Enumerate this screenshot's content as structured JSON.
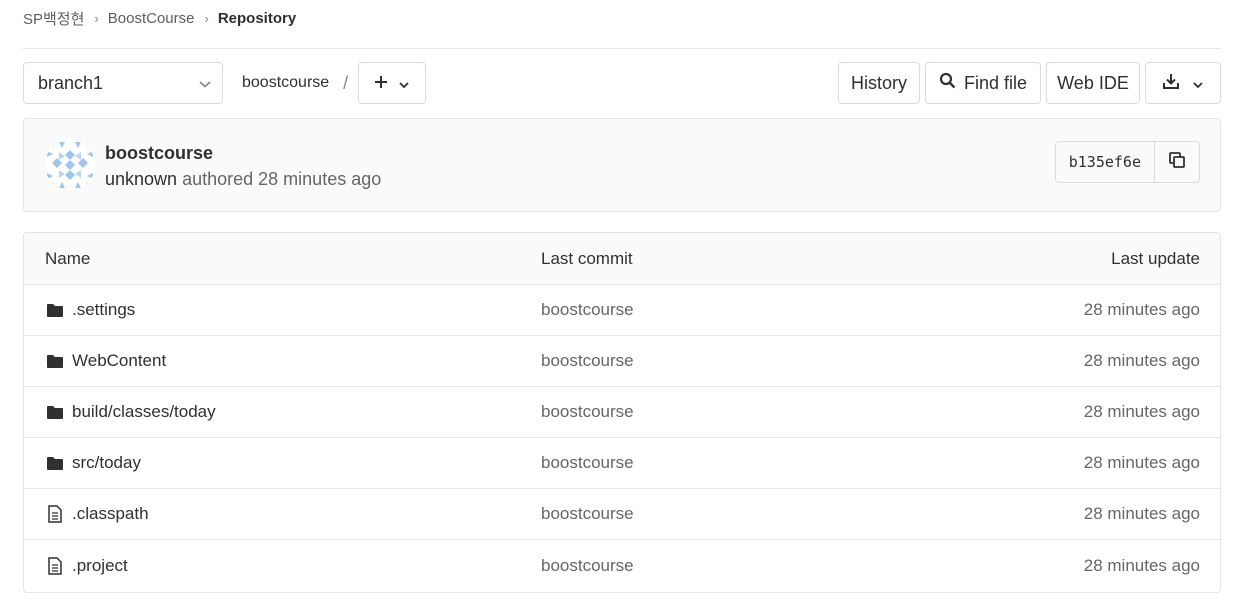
{
  "breadcrumb": {
    "items": [
      "SP백정현",
      "BoostCourse",
      "Repository"
    ]
  },
  "toolbar": {
    "branch": "branch1",
    "path": "boostcourse",
    "path_separator": "/",
    "history_label": "History",
    "find_file_label": "Find file",
    "web_ide_label": "Web IDE"
  },
  "commit": {
    "title": "boostcourse",
    "author": "unknown",
    "action": "authored",
    "time": "28 minutes ago",
    "sha": "b135ef6e"
  },
  "table": {
    "headers": {
      "name": "Name",
      "last_commit": "Last commit",
      "last_update": "Last update"
    },
    "rows": [
      {
        "icon": "folder-icon",
        "name": ".settings",
        "commit": "boostcourse",
        "updated": "28 minutes ago"
      },
      {
        "icon": "folder-icon",
        "name": "WebContent",
        "commit": "boostcourse",
        "updated": "28 minutes ago"
      },
      {
        "icon": "folder-icon",
        "name": "build/classes/today",
        "commit": "boostcourse",
        "updated": "28 minutes ago"
      },
      {
        "icon": "folder-icon",
        "name": "src/today",
        "commit": "boostcourse",
        "updated": "28 minutes ago"
      },
      {
        "icon": "file-icon",
        "name": ".classpath",
        "commit": "boostcourse",
        "updated": "28 minutes ago"
      },
      {
        "icon": "file-icon",
        "name": ".project",
        "commit": "boostcourse",
        "updated": "28 minutes ago"
      }
    ]
  },
  "colors": {
    "border": "#e5e5e5",
    "text": "#303030",
    "muted": "#666666",
    "avatar": "#9ec5ea"
  }
}
